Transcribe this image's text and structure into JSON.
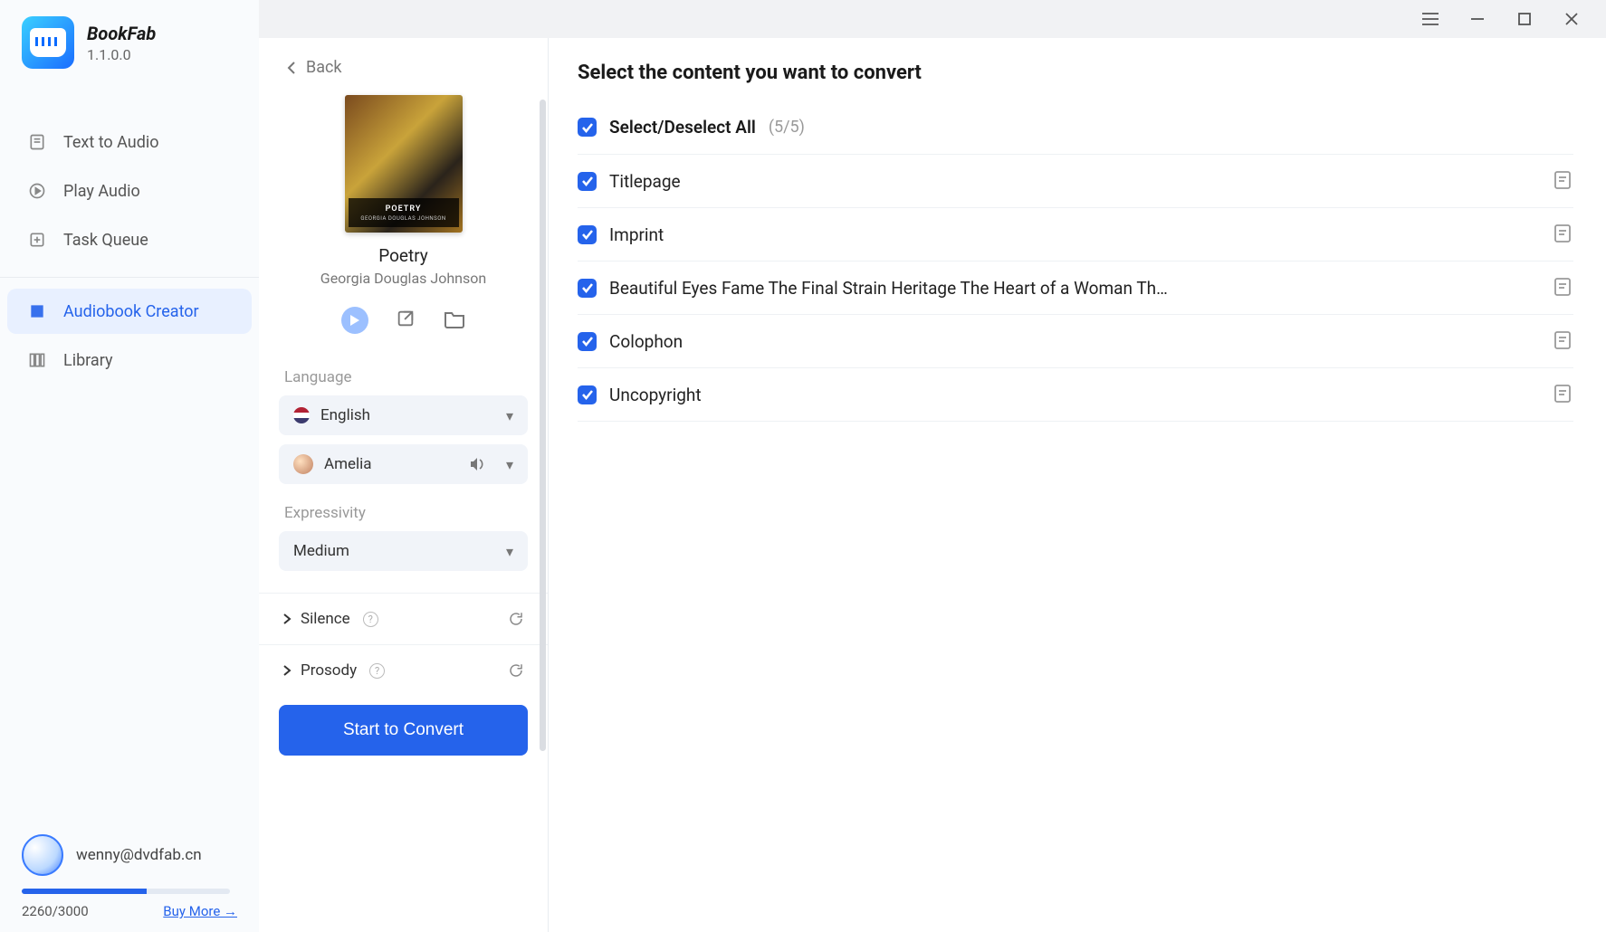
{
  "brand": {
    "name": "BookFab",
    "version": "1.1.0.0"
  },
  "nav": {
    "text_to_audio": "Text to Audio",
    "play_audio": "Play Audio",
    "task_queue": "Task Queue",
    "audiobook_creator": "Audiobook Creator",
    "library": "Library"
  },
  "user": {
    "email": "wenny@dvdfab.cn",
    "credits": "2260/3000",
    "buy_more": "Buy More →"
  },
  "back_label": "Back",
  "book": {
    "cover_title": "POETRY",
    "cover_author": "GEORGIA DOUGLAS JOHNSON",
    "title": "Poetry",
    "author": "Georgia Douglas Johnson"
  },
  "settings": {
    "language_label": "Language",
    "language_value": "English",
    "voice_value": "Amelia",
    "expressivity_label": "Expressivity",
    "expressivity_value": "Medium",
    "silence_label": "Silence",
    "prosody_label": "Prosody"
  },
  "convert_label": "Start to Convert",
  "chapters": {
    "heading": "Select the content you want to convert",
    "select_all": "Select/Deselect All",
    "count": "(5/5)",
    "items": [
      "Titlepage",
      "Imprint",
      "Beautiful Eyes Fame The Final Strain Heritage The Heart of a Woman Th…",
      "Colophon",
      "Uncopyright"
    ]
  }
}
